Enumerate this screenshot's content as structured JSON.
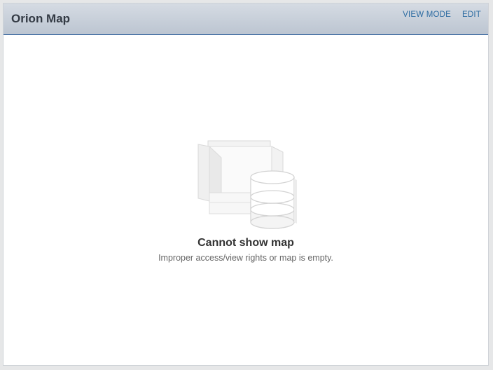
{
  "header": {
    "title": "Orion Map",
    "view_mode_label": "VIEW MODE",
    "edit_label": "EDIT"
  },
  "empty_state": {
    "icon": "map-database-icon",
    "title": "Cannot show map",
    "subtitle": "Improper access/view rights or map is empty."
  },
  "colors": {
    "header_top": "#d5dbe3",
    "header_bottom": "#bcc5d1",
    "header_border": "#2d5f9a",
    "link": "#2d6ca2"
  }
}
